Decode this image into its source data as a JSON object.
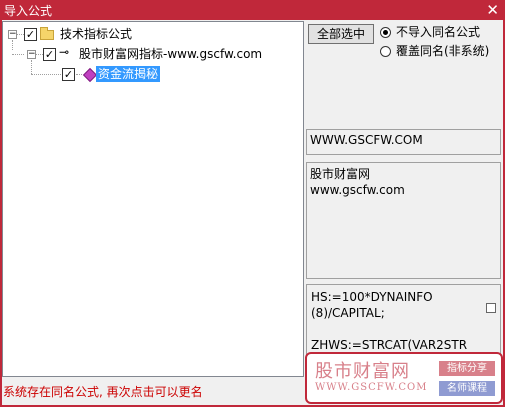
{
  "window": {
    "title": "导入公式",
    "close_glyph": "✕"
  },
  "tree": {
    "root": {
      "label": "技术指标公式",
      "checked": true,
      "expander": "−"
    },
    "child": {
      "label": "股市财富网指标-www.gscfw.com",
      "checked": true,
      "expander": "−"
    },
    "leaf": {
      "label": "资金流揭秘",
      "checked": true,
      "selected": true
    }
  },
  "controls": {
    "select_all_label": "全部选中",
    "option_no_import": "不导入同名公式",
    "option_overwrite": "覆盖同名(非系统)",
    "selected_option": "option_no_import"
  },
  "info": {
    "url_text": "WWW.GSCFW.COM",
    "description": "股市财富网\nwww.gscfw.com",
    "formula_text": "HS:=100*DYNAINFO\n(8)/CAPITAL;\n\nZHWS:=STRCAT(VAR2STR"
  },
  "status": {
    "message": "系统存在同名公式, 再次点击可以更名",
    "color": "#cc0000"
  },
  "watermark": {
    "site_name": "股市财富网",
    "site_url": "WWW.GSCFW.COM",
    "badge_1": "指标分享",
    "badge_2": "名师课程"
  },
  "colors": {
    "titlebar": "#c0283a",
    "selection": "#3399ff"
  }
}
